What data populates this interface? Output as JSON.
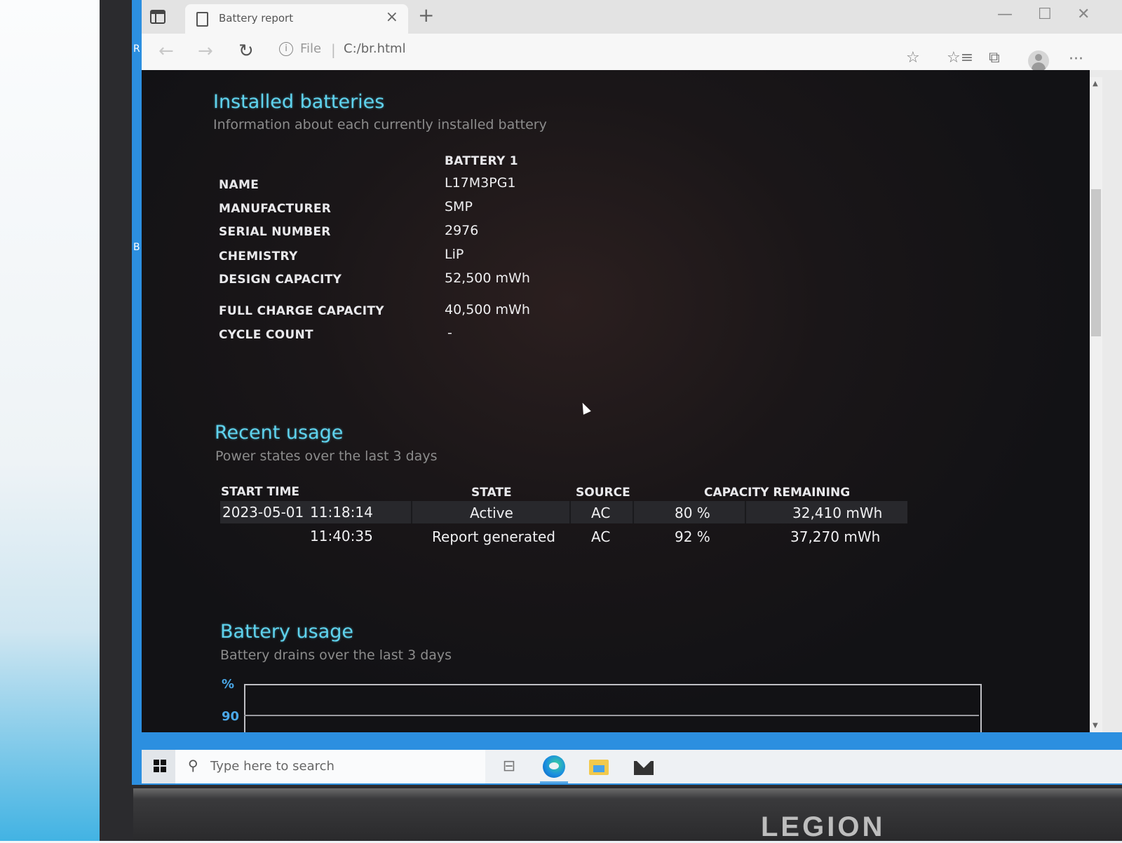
{
  "browser": {
    "tab_title": "Battery report",
    "tab_close": "×",
    "new_tab": "+",
    "window_controls": {
      "minimize": "—",
      "maximize": "☐",
      "close": "✕"
    },
    "nav": {
      "back": "←",
      "forward": "→",
      "refresh": "↻"
    },
    "address": {
      "info": "i",
      "scheme_label": "File",
      "separator": "|",
      "url": "C:/br.html"
    },
    "toolbar_icons": [
      "add-favorite-icon",
      "favorites-icon",
      "collections-icon",
      "profile-icon",
      "more-icon"
    ],
    "toolbar_glyphs": {
      "add_favorite": "☆",
      "favorites": "☆≡",
      "collections": "⧉",
      "more": "···"
    }
  },
  "desktop_letters": [
    "R",
    "B"
  ],
  "installed_batteries": {
    "title": "Installed batteries",
    "subtitle": "Information about each currently installed battery",
    "column_header": "BATTERY 1",
    "rows": [
      {
        "label": "NAME",
        "value": "L17M3PG1"
      },
      {
        "label": "MANUFACTURER",
        "value": "SMP"
      },
      {
        "label": "SERIAL NUMBER",
        "value": "2976"
      },
      {
        "label": "CHEMISTRY",
        "value": "LiP"
      },
      {
        "label": "DESIGN CAPACITY",
        "value": "52,500 mWh"
      },
      {
        "label": "FULL CHARGE CAPACITY",
        "value": "40,500 mWh"
      },
      {
        "label": "CYCLE COUNT",
        "value": "-"
      }
    ]
  },
  "recent_usage": {
    "title": "Recent usage",
    "subtitle": "Power states over the last 3 days",
    "headers": {
      "start_time": "START TIME",
      "state": "STATE",
      "source": "SOURCE",
      "capacity": "CAPACITY REMAINING"
    },
    "rows": [
      {
        "date": "2023-05-01",
        "time": "11:18:14",
        "state": "Active",
        "source": "AC",
        "percent": "80 %",
        "mwh": "32,410 mWh"
      },
      {
        "date": "",
        "time": "11:40:35",
        "state": "Report generated",
        "source": "AC",
        "percent": "92 %",
        "mwh": "37,270 mWh"
      }
    ]
  },
  "battery_usage": {
    "title": "Battery usage",
    "subtitle": "Battery drains over the last 3 days"
  },
  "chart_data": {
    "type": "line",
    "title": "Battery usage",
    "subtitle": "Battery drains over the last 3 days",
    "ylabel": "%",
    "y_ticks": [
      "90"
    ],
    "series": [],
    "grid": true
  },
  "taskbar": {
    "search_placeholder": "Type here to search",
    "apps": [
      "task-view",
      "edge",
      "file-explorer",
      "mail"
    ]
  },
  "laptop_brand": "LEGION"
}
